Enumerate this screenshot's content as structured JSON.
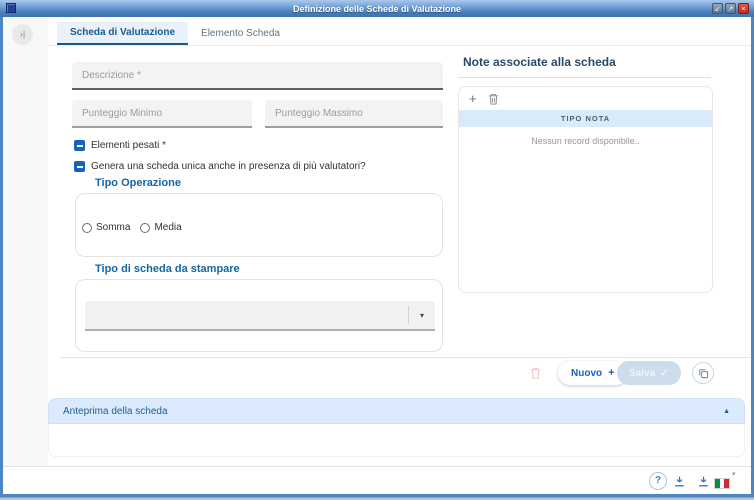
{
  "window": {
    "title": "Definizione delle Schede di Valutazione",
    "minimize_glyph": "↙",
    "maximize_glyph": "↗",
    "close_glyph": "×"
  },
  "sidebar": {
    "expand_glyph": "›|"
  },
  "tabs": [
    {
      "label": "Scheda di Valutazione",
      "active": true
    },
    {
      "label": "Elemento Scheda",
      "active": false
    }
  ],
  "form": {
    "descrizione_placeholder": "Descrizione *",
    "punteggio_minimo_placeholder": "Punteggio Minimo",
    "punteggio_massimo_placeholder": "Punteggio Massimo",
    "checkbox_elementi_pesati": "Elementi pesati *",
    "checkbox_scheda_unica": "Genera una scheda unica anche in presenza di più valutatori?",
    "tipo_operazione_legend": "Tipo Operazione",
    "radio_somma": "Somma",
    "radio_media": "Media",
    "tipo_scheda_legend": "Tipo di scheda da stampare",
    "tipo_scheda_value": "",
    "dropdown_glyph": "▾"
  },
  "note_panel": {
    "title": "Note associate alla scheda",
    "add_glyph": "+",
    "table_header": "TIPO NOTA",
    "empty_message": "Nessun record disponibile.."
  },
  "actions": {
    "nuovo_label": "Nuovo",
    "nuovo_glyph": "+",
    "salva_label": "Salva",
    "salva_glyph": "✓"
  },
  "preview": {
    "title": "Anteprima della scheda",
    "collapse_glyph": "▲"
  },
  "footer": {
    "help_glyph": "?",
    "flag_caret_glyph": "▾"
  },
  "colors": {
    "accent": "#1565c0",
    "tab_active": "#1b5a8c",
    "titlebar": "#5a8fc7",
    "table_header_bg": "#d9eafa",
    "preview_header_bg": "#dbeafc",
    "flag_green": "#009246",
    "flag_red": "#ce2b37"
  }
}
